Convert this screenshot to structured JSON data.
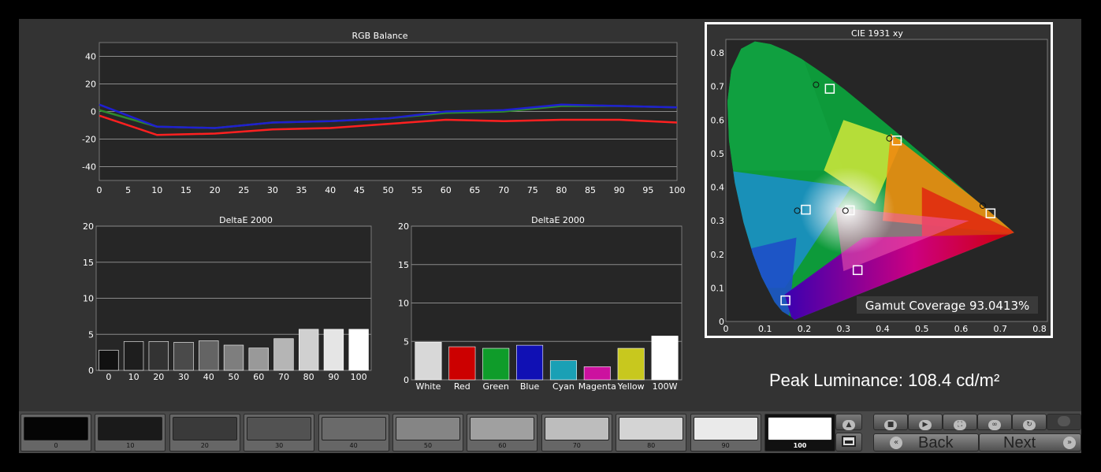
{
  "rgb_balance": {
    "title": "RGB Balance",
    "x_ticks": [
      "0",
      "5",
      "10",
      "15",
      "20",
      "25",
      "30",
      "35",
      "40",
      "45",
      "50",
      "55",
      "60",
      "65",
      "70",
      "75",
      "80",
      "85",
      "90",
      "95",
      "100"
    ],
    "y_ticks": [
      "40",
      "20",
      "0",
      "-20",
      "-40"
    ],
    "chart_data": {
      "type": "line",
      "x": [
        0,
        10,
        20,
        30,
        40,
        50,
        60,
        70,
        80,
        90,
        100
      ],
      "xlim": [
        0,
        100
      ],
      "ylim": [
        -50,
        50
      ],
      "series": [
        {
          "color": "#ff2020",
          "values": [
            -3,
            -17,
            -16,
            -13,
            -12,
            -9,
            -6,
            -7,
            -6,
            -6,
            -8
          ]
        },
        {
          "color": "#2e8b2e",
          "values": [
            1,
            -11,
            -12,
            -8,
            -7,
            -5,
            -1,
            0,
            4,
            4,
            3
          ]
        },
        {
          "color": "#1f1fd0",
          "values": [
            5,
            -11,
            -12,
            -8,
            -7,
            -5,
            0,
            1,
            5,
            4,
            3
          ]
        }
      ]
    }
  },
  "deltae_gray": {
    "title": "DeltaE 2000",
    "y_ticks": [
      "20",
      "15",
      "10",
      "5",
      "0"
    ],
    "chart_data": {
      "type": "bar",
      "categories": [
        "0",
        "10",
        "20",
        "30",
        "40",
        "50",
        "60",
        "70",
        "80",
        "90",
        "100"
      ],
      "values": [
        2.8,
        4.0,
        4.0,
        3.9,
        4.1,
        3.5,
        3.1,
        4.4,
        5.7,
        5.7,
        5.7
      ],
      "ylim": [
        0,
        20
      ],
      "colors": [
        "#111111",
        "#1e1e1e",
        "#333333",
        "#4a4a4a",
        "#646464",
        "#7e7e7e",
        "#999999",
        "#b5b5b5",
        "#d0d0d0",
        "#e5e5e5",
        "#ffffff"
      ]
    }
  },
  "deltae_color": {
    "title": "DeltaE 2000",
    "y_ticks": [
      "20",
      "15",
      "10",
      "5",
      "0"
    ],
    "chart_data": {
      "type": "bar",
      "categories": [
        "White",
        "Red",
        "Green",
        "Blue",
        "Cyan",
        "Magenta",
        "Yellow",
        "100W"
      ],
      "values": [
        4.9,
        4.3,
        4.1,
        4.5,
        2.5,
        1.7,
        4.1,
        5.7
      ],
      "ylim": [
        0,
        20
      ],
      "colors": [
        "#d8d8d8",
        "#cc0000",
        "#0f9c2a",
        "#1010b4",
        "#1aa0b5",
        "#cc119f",
        "#c8c81e",
        "#ffffff"
      ]
    }
  },
  "cie": {
    "title": "CIE 1931 xy",
    "x_ticks": [
      "0",
      "0.1",
      "0.2",
      "0.3",
      "0.4",
      "0.5",
      "0.6",
      "0.7",
      "0.8"
    ],
    "y_ticks": [
      "0.8",
      "0.7",
      "0.6",
      "0.5",
      "0.4",
      "0.3",
      "0.2",
      "0.1",
      "0"
    ],
    "gamut_coverage": "Gamut Coverage 93.0413%",
    "chart_data": {
      "type": "scatter",
      "xlim": [
        0,
        0.82
      ],
      "ylim": [
        0,
        0.84
      ],
      "targets": [
        [
          0.64,
          0.33
        ],
        [
          0.3,
          0.6
        ],
        [
          0.15,
          0.06
        ],
        [
          0.3127,
          0.329
        ],
        [
          0.225,
          0.329
        ],
        [
          0.321,
          0.154
        ],
        [
          0.419,
          0.505
        ]
      ],
      "measured": [
        [
          0.675,
          0.322
        ],
        [
          0.265,
          0.693
        ],
        [
          0.152,
          0.063
        ],
        [
          0.316,
          0.331
        ],
        [
          0.204,
          0.333
        ],
        [
          0.336,
          0.153
        ],
        [
          0.436,
          0.539
        ]
      ],
      "targets_drawn": [
        [
          0.655,
          0.345
        ],
        [
          0.23,
          0.705
        ],
        [
          0.305,
          0.33
        ],
        [
          0.182,
          0.33
        ],
        [
          0.417,
          0.545
        ]
      ]
    }
  },
  "peak_luminance": "Peak Luminance: 108.4 cd/m²",
  "patches": [
    {
      "label": "0",
      "color": "#050505"
    },
    {
      "label": "10",
      "color": "#1a1a1a"
    },
    {
      "label": "20",
      "color": "#3a3a3a"
    },
    {
      "label": "30",
      "color": "#525252"
    },
    {
      "label": "40",
      "color": "#6a6a6a"
    },
    {
      "label": "50",
      "color": "#858585"
    },
    {
      "label": "60",
      "color": "#a0a0a0"
    },
    {
      "label": "70",
      "color": "#bdbdbd"
    },
    {
      "label": "80",
      "color": "#d4d4d4"
    },
    {
      "label": "90",
      "color": "#eaeaea"
    },
    {
      "label": "100",
      "color": "#ffffff"
    }
  ],
  "active_patch": "100",
  "nav": {
    "back_label": "Back",
    "next_label": "Next"
  },
  "icons": [
    "stop-icon",
    "play-icon",
    "fullscreen-icon",
    "loop-icon",
    "refresh-icon",
    "blank-icon",
    "up-icon",
    "pattern-icon"
  ]
}
